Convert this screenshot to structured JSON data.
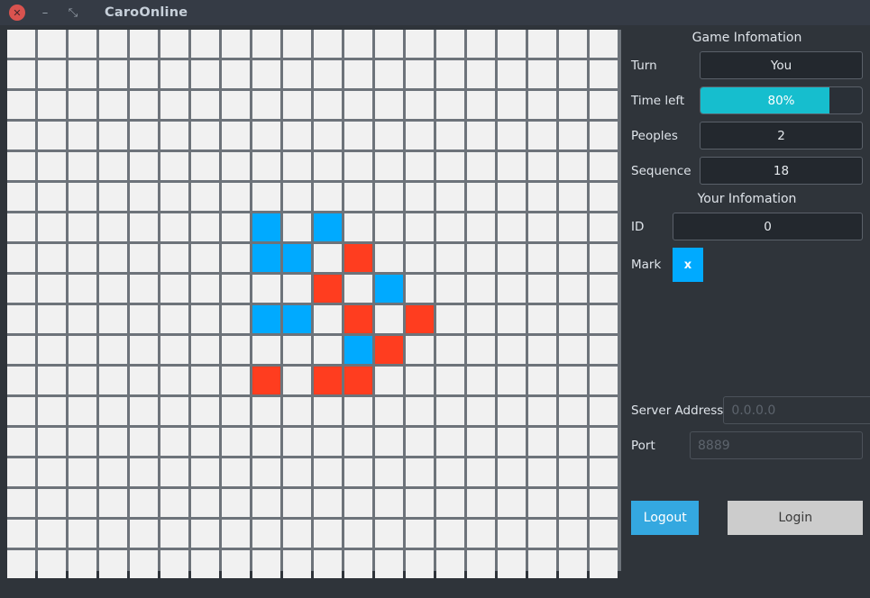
{
  "window": {
    "title": "CaroOnline",
    "close_icon": "close-icon",
    "minimize_icon": "minimize-icon",
    "maximize_icon": "maximize-icon",
    "close_glyph": "✕",
    "minimize_glyph": "–",
    "maximize_glyph": "⤡"
  },
  "colors": {
    "player_x": "#00aaff",
    "player_o": "#ff3d1f",
    "progress": "#16bece",
    "accent_button": "#34a8e0",
    "window_bg": "#2f343a",
    "board_line": "#6d737a",
    "cell_empty": "#f1f1f1"
  },
  "game_info": {
    "section_title": "Game Infomation",
    "turn_label": "Turn",
    "turn_value": "You",
    "time_label": "Time left",
    "time_value": "80%",
    "time_percent": 80,
    "peoples_label": "Peoples",
    "peoples_value": "2",
    "sequence_label": "Sequence",
    "sequence_value": "18"
  },
  "your_info": {
    "section_title": "Your Infomation",
    "id_label": "ID",
    "id_value": "0",
    "mark_label": "Mark",
    "mark_value": "x"
  },
  "connection": {
    "server_label": "Server Address",
    "server_value": "",
    "server_placeholder": "0.0.0.0",
    "port_label": "Port",
    "port_value": "",
    "port_placeholder": "8889"
  },
  "actions": {
    "logout_label": "Logout",
    "login_label": "Login"
  },
  "board": {
    "columns": 20,
    "rows": 18,
    "moves": [
      {
        "row": 6,
        "col": 8,
        "mark": "x"
      },
      {
        "row": 6,
        "col": 10,
        "mark": "x"
      },
      {
        "row": 7,
        "col": 8,
        "mark": "x"
      },
      {
        "row": 7,
        "col": 9,
        "mark": "x"
      },
      {
        "row": 7,
        "col": 11,
        "mark": "o"
      },
      {
        "row": 8,
        "col": 10,
        "mark": "o"
      },
      {
        "row": 8,
        "col": 12,
        "mark": "x"
      },
      {
        "row": 9,
        "col": 8,
        "mark": "x"
      },
      {
        "row": 9,
        "col": 9,
        "mark": "x"
      },
      {
        "row": 9,
        "col": 11,
        "mark": "o"
      },
      {
        "row": 9,
        "col": 13,
        "mark": "o"
      },
      {
        "row": 10,
        "col": 11,
        "mark": "x"
      },
      {
        "row": 10,
        "col": 12,
        "mark": "o"
      },
      {
        "row": 11,
        "col": 8,
        "mark": "o"
      },
      {
        "row": 11,
        "col": 10,
        "mark": "o"
      },
      {
        "row": 11,
        "col": 11,
        "mark": "o"
      }
    ]
  }
}
